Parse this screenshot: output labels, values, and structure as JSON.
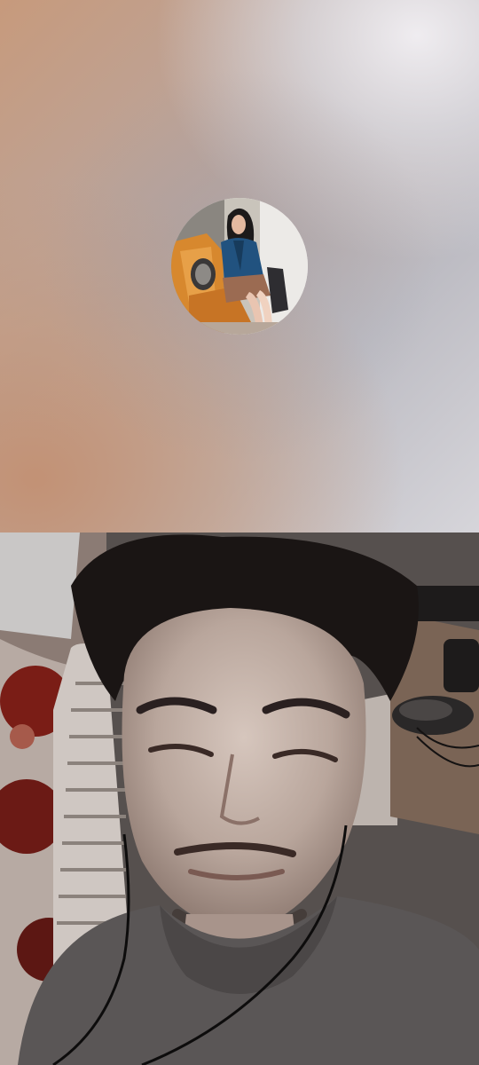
{
  "call": {
    "remote_participant": {
      "video": "off",
      "avatar_icon": "profile-photo"
    },
    "local_preview": {
      "video": "on"
    }
  },
  "colors": {
    "remote_bg_warm": "#c79a7c",
    "remote_bg_cool": "#d6d5da",
    "local_bg": "#3a3534"
  }
}
